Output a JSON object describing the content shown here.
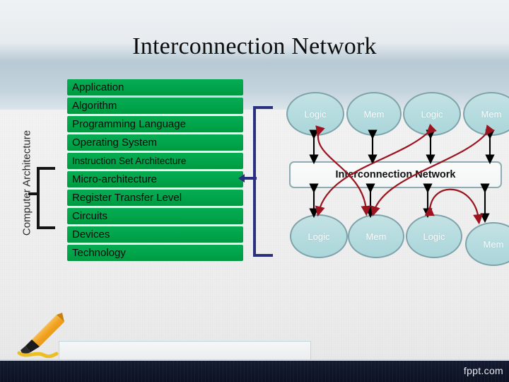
{
  "slide": {
    "title": "Interconnection Network",
    "watermark": "fppt.com",
    "vertical_label": "Computer Architecture"
  },
  "stack": {
    "layers": [
      {
        "label": "Application",
        "size": "normal"
      },
      {
        "label": "Algorithm",
        "size": "normal"
      },
      {
        "label": "Programming Language",
        "size": "normal"
      },
      {
        "label": "Operating System",
        "size": "normal"
      },
      {
        "label": "Instruction Set Architecture",
        "size": "small"
      },
      {
        "label": "Micro-architecture",
        "size": "normal"
      },
      {
        "label": "Register Transfer Level",
        "size": "normal"
      },
      {
        "label": "Circuits",
        "size": "normal"
      },
      {
        "label": "Devices",
        "size": "normal"
      },
      {
        "label": "Technology",
        "size": "normal"
      }
    ],
    "bar_color": "#00a44b",
    "text_color": "#0a0a0a"
  },
  "diagram": {
    "network_label": "Interconnection Network",
    "node_fill": "#b6dcdf",
    "node_border": "#7ea3ab",
    "node_text_color": "#ffffff",
    "arrow_color": "#000000",
    "curve_color": "#9c1420",
    "top_nodes": [
      {
        "label": "Logic"
      },
      {
        "label": "Mem"
      },
      {
        "label": "Logic"
      },
      {
        "label": "Mem"
      }
    ],
    "bottom_nodes": [
      {
        "label": "Logic"
      },
      {
        "label": "Mem"
      },
      {
        "label": "Logic"
      },
      {
        "label": "Mem"
      }
    ]
  },
  "brace": {
    "color": "#2b2f7f"
  },
  "caption_box": {
    "text": ""
  }
}
